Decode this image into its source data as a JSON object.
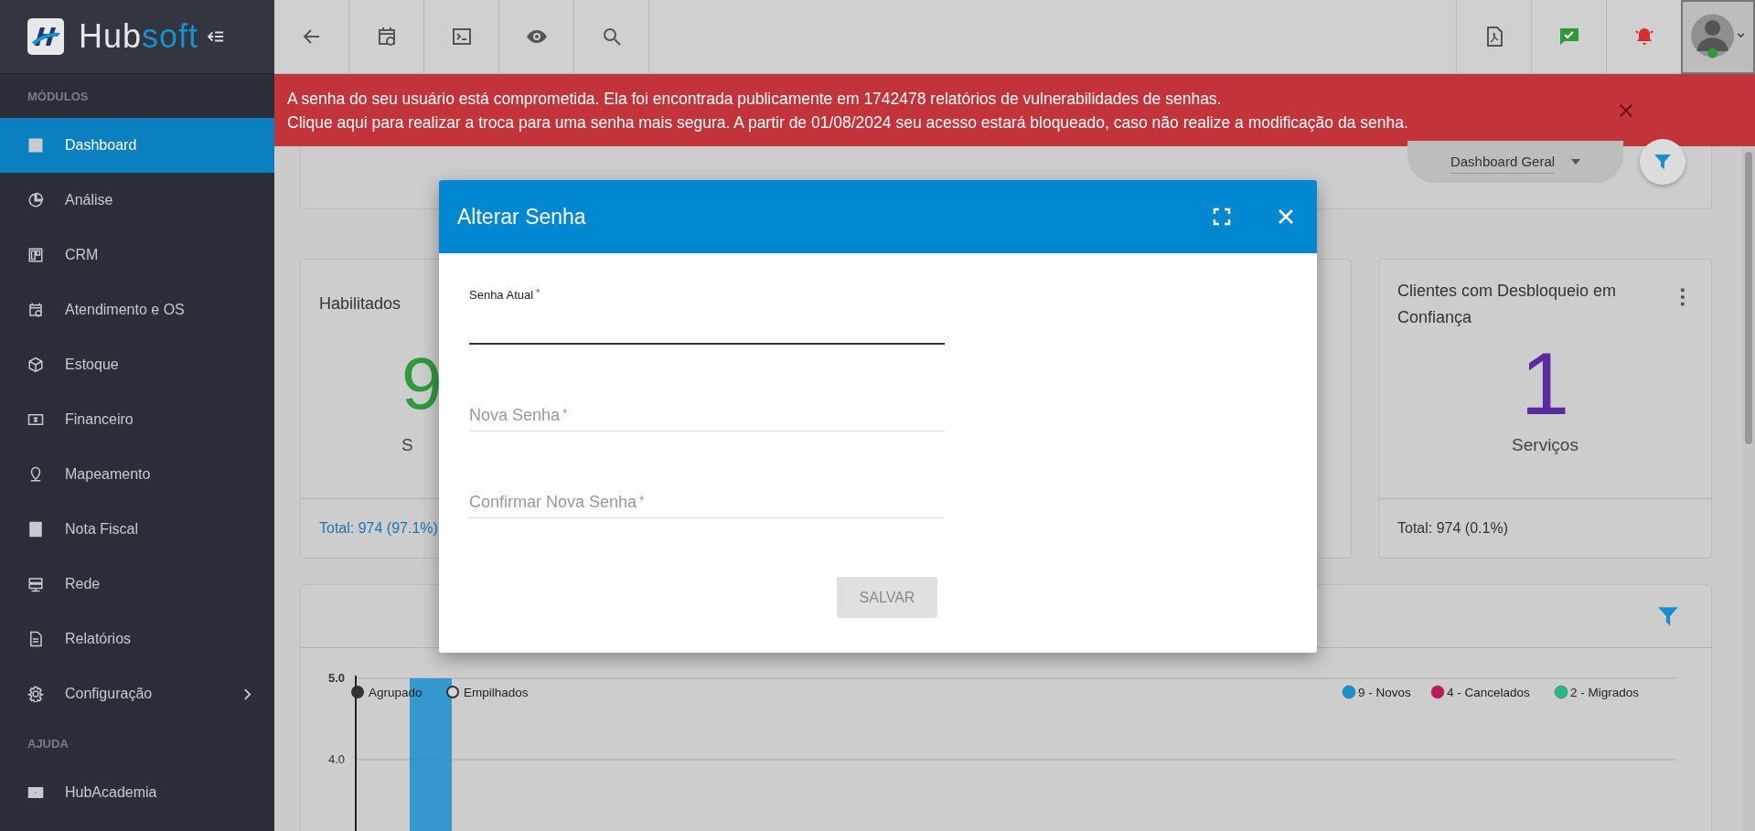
{
  "logo": {
    "part_1": "Hub",
    "part_2": "soft"
  },
  "sidebar": {
    "sections": [
      {
        "title": "MÓDULOS",
        "items": [
          {
            "label": "Dashboard",
            "selected": true,
            "submenu": false
          },
          {
            "label": "Análise",
            "selected": false,
            "submenu": false
          },
          {
            "label": "CRM",
            "selected": false,
            "submenu": false
          },
          {
            "label": "Atendimento e OS",
            "selected": false,
            "submenu": false
          },
          {
            "label": "Estoque",
            "selected": false,
            "submenu": false
          },
          {
            "label": "Financeiro",
            "selected": false,
            "submenu": false
          },
          {
            "label": "Mapeamento",
            "selected": false,
            "submenu": false
          },
          {
            "label": "Nota Fiscal",
            "selected": false,
            "submenu": false
          },
          {
            "label": "Rede",
            "selected": false,
            "submenu": false
          },
          {
            "label": "Relatórios",
            "selected": false,
            "submenu": false
          },
          {
            "label": "Configuração",
            "selected": false,
            "submenu": true
          }
        ]
      },
      {
        "title": "AJUDA",
        "items": [
          {
            "label": "HubAcademia",
            "selected": false,
            "submenu": false
          }
        ]
      }
    ]
  },
  "alert": {
    "lines": [
      "A senha do seu usuário está comprometida. Ela foi encontrada publicamente em 1742478 relatórios de vulnerabilidades de senhas.",
      "Clique aqui para realizar a troca para uma senha mais segura. A partir de 01/08/2024 seu acesso estará bloqueado, caso não realize a modificação da senha."
    ]
  },
  "dashboard_select": {
    "value": "Dashboard Geral"
  },
  "cards": [
    {
      "kind": "stat",
      "title": "Habilitados",
      "value": "9",
      "unit": "S",
      "footer": "Total: 974 (97.1%)",
      "color": "#2e9a3a"
    },
    {
      "kind": "hidden"
    },
    {
      "kind": "stat",
      "title": "Clientes com Desbloqueio em Confiança",
      "value": "1",
      "unit": "Serviços",
      "footer": "Total:  974 (0.1%)",
      "color": "#5b2a9e"
    }
  ],
  "chart": {
    "modes": [
      {
        "label": "Agrupado",
        "selected": true
      },
      {
        "label": "Empilhados",
        "selected": false
      }
    ],
    "chart_data": {
      "type": "bar",
      "ylim": [
        3,
        5
      ],
      "yticks": [
        {
          "value": 4,
          "label": "4.0"
        },
        {
          "value": 5,
          "label": "5.0"
        }
      ],
      "series": [
        {
          "name": "9 - Novos",
          "color": "#1a8fd0",
          "values": [
            5
          ]
        },
        {
          "name": "4 - Cancelados",
          "color": "#c2185b",
          "values": [
            null
          ]
        },
        {
          "name": "2 - Migrados",
          "color": "#26b98a",
          "values": [
            null
          ]
        }
      ]
    }
  },
  "modal": {
    "title": "Alterar Senha",
    "fields": [
      {
        "label": "Senha Atual",
        "required_mark": "*",
        "focused": true
      },
      {
        "label": "Nova Senha",
        "required_mark": "*",
        "focused": false
      },
      {
        "label": "Confirmar Nova Senha",
        "required_mark": "*",
        "focused": false
      }
    ],
    "button": {
      "label": "SALVAR",
      "disabled": true
    }
  }
}
